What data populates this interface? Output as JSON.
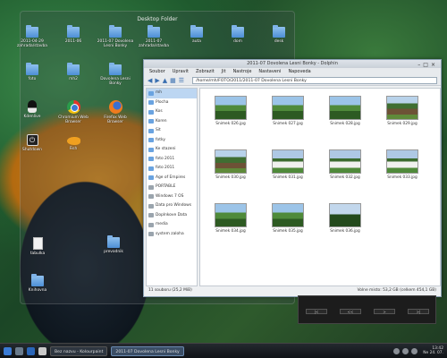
{
  "desktop_panel": {
    "title": "Desktop Folder"
  },
  "desktop_icons": [
    {
      "label": "2011-04-29 zahrada/stavba",
      "kind": "folder"
    },
    {
      "label": "2011-06",
      "kind": "folder"
    },
    {
      "label": "2011-07 Dovolena Lesni Bonky",
      "kind": "folder"
    },
    {
      "label": "2011-07 zahrada/stavba",
      "kind": "folder"
    },
    {
      "label": "auta",
      "kind": "folder"
    },
    {
      "label": "dom",
      "kind": "folder"
    },
    {
      "label": "desk",
      "kind": "folder"
    },
    {
      "label": "foto",
      "kind": "folder"
    },
    {
      "label": "mh2",
      "kind": "folder"
    },
    {
      "label": "Dovolena Lesni Bonky",
      "kind": "folder"
    },
    {
      "label": "Kdenlive",
      "kind": "tux"
    },
    {
      "label": "Chromium Web Browser",
      "kind": "chrome"
    },
    {
      "label": "Firefox Web Browser",
      "kind": "firefox"
    },
    {
      "label": "Shutdown",
      "kind": "power"
    },
    {
      "label": "Fish",
      "kind": "fish"
    },
    {
      "label": "tabulka",
      "kind": "doc"
    },
    {
      "label": "prevodnik",
      "kind": "folder"
    },
    {
      "label": "Knihovna",
      "kind": "folder"
    }
  ],
  "file_manager": {
    "title": "2011-07 Dovolena Lesni Bonky - Dolphin",
    "menu": [
      "Soubor",
      "Upravit",
      "Zobrazit",
      "Jit",
      "Nastroje",
      "Nastaveni",
      "Napoveda"
    ],
    "path": "/home/mh/FOTO/2011/2011-07 Dovolena Lesni Bonky",
    "places": [
      {
        "label": "mh",
        "kind": "place",
        "selected": true
      },
      {
        "label": "Plocha",
        "kind": "place"
      },
      {
        "label": "Kos",
        "kind": "place"
      },
      {
        "label": "Koren",
        "kind": "place"
      },
      {
        "label": "Sit",
        "kind": "place"
      },
      {
        "label": "fotky",
        "kind": "place"
      },
      {
        "label": "Ke stazeni",
        "kind": "place"
      },
      {
        "label": "foto 2011",
        "kind": "place"
      },
      {
        "label": "foto 2011",
        "kind": "place"
      },
      {
        "label": "Age of Empires",
        "kind": "place"
      },
      {
        "label": "PORTABLE",
        "kind": "device"
      },
      {
        "label": "Windows 7 OS",
        "kind": "device"
      },
      {
        "label": "Data pro Windows",
        "kind": "device"
      },
      {
        "label": "Doplnkove Data",
        "kind": "device"
      },
      {
        "label": "media",
        "kind": "device"
      },
      {
        "label": "system zaloha",
        "kind": "device"
      }
    ],
    "files": [
      {
        "label": "Snimek 026.jpg",
        "style": ""
      },
      {
        "label": "Snimek 027.jpg",
        "style": ""
      },
      {
        "label": "Snimek 028.jpg",
        "style": ""
      },
      {
        "label": "Snimek 029.jpg",
        "style": "h"
      },
      {
        "label": "Snimek 030.jpg",
        "style": "h"
      },
      {
        "label": "Snimek 031.jpg",
        "style": "w"
      },
      {
        "label": "Snimek 032.jpg",
        "style": "w"
      },
      {
        "label": "Snimek 033.jpg",
        "style": "w"
      },
      {
        "label": "Snimek 034.jpg",
        "style": ""
      },
      {
        "label": "Snimek 035.jpg",
        "style": ""
      },
      {
        "label": "Snimek 036.jpg",
        "style": "t"
      }
    ],
    "status_left": "11 souboru (25,2 MiB)",
    "status_right": "Volne misto: 53,2 GB (celkem 454,1 GB)"
  },
  "media_controls": [
    "|<",
    "<<",
    ">",
    ">|"
  ],
  "taskbar": {
    "tasks": [
      {
        "label": "Bez nazvu - Kolourpaint",
        "active": false
      },
      {
        "label": "2011-07 Dovolena Lesni Bonky",
        "active": true
      }
    ],
    "time": "13:42",
    "date": "Ne 24. 07."
  }
}
